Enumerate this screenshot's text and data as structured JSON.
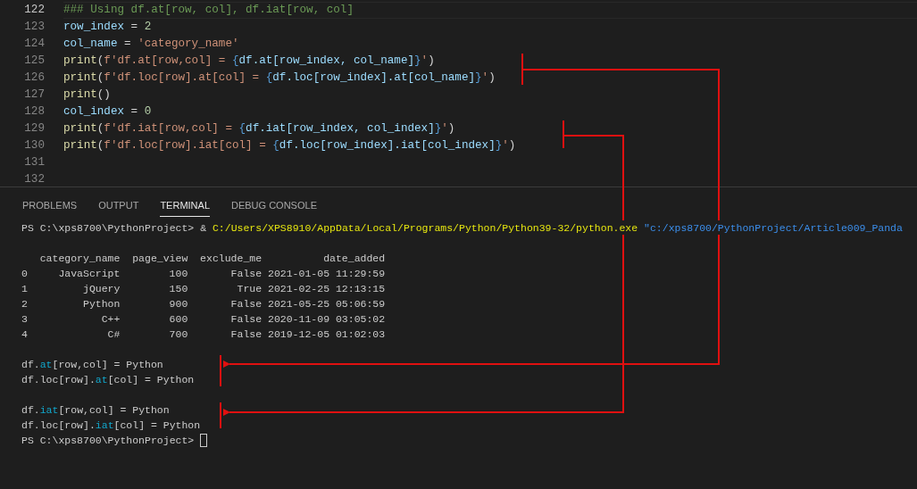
{
  "editor": {
    "lines": [
      {
        "number": "122",
        "active": true,
        "tokens": [
          {
            "text": "### Using df.at[row, col], df.iat[row, col]",
            "kind": "comment"
          }
        ]
      },
      {
        "number": "123",
        "active": false,
        "tokens": [
          {
            "text": "row_index",
            "kind": "var"
          },
          {
            "text": " = ",
            "kind": "op"
          },
          {
            "text": "2",
            "kind": "num"
          }
        ]
      },
      {
        "number": "124",
        "active": false,
        "tokens": [
          {
            "text": "col_name",
            "kind": "var"
          },
          {
            "text": " = ",
            "kind": "op"
          },
          {
            "text": "'category_name'",
            "kind": "str"
          }
        ]
      },
      {
        "number": "125",
        "active": false,
        "tokens": [
          {
            "text": "print",
            "kind": "func"
          },
          {
            "text": "(",
            "kind": "op"
          },
          {
            "text": "f'df.at[row,col] = ",
            "kind": "str"
          },
          {
            "text": "{",
            "kind": "brace"
          },
          {
            "text": "df.at[row_index, col_name]",
            "kind": "var"
          },
          {
            "text": "}",
            "kind": "brace"
          },
          {
            "text": "'",
            "kind": "str"
          },
          {
            "text": ")",
            "kind": "op"
          }
        ]
      },
      {
        "number": "126",
        "active": false,
        "tokens": [
          {
            "text": "print",
            "kind": "func"
          },
          {
            "text": "(",
            "kind": "op"
          },
          {
            "text": "f'df.loc[row].at[col] = ",
            "kind": "str"
          },
          {
            "text": "{",
            "kind": "brace"
          },
          {
            "text": "df.loc[row_index].at[col_name]",
            "kind": "var"
          },
          {
            "text": "}",
            "kind": "brace"
          },
          {
            "text": "'",
            "kind": "str"
          },
          {
            "text": ")",
            "kind": "op"
          }
        ]
      },
      {
        "number": "127",
        "active": false,
        "tokens": [
          {
            "text": "print",
            "kind": "func"
          },
          {
            "text": "()",
            "kind": "op"
          }
        ]
      },
      {
        "number": "128",
        "active": false,
        "tokens": [
          {
            "text": "col_index",
            "kind": "var"
          },
          {
            "text": " = ",
            "kind": "op"
          },
          {
            "text": "0",
            "kind": "num"
          }
        ]
      },
      {
        "number": "129",
        "active": false,
        "tokens": [
          {
            "text": "print",
            "kind": "func"
          },
          {
            "text": "(",
            "kind": "op"
          },
          {
            "text": "f'df.iat[row,col] = ",
            "kind": "str"
          },
          {
            "text": "{",
            "kind": "brace"
          },
          {
            "text": "df.iat[row_index, col_index]",
            "kind": "var"
          },
          {
            "text": "}",
            "kind": "brace"
          },
          {
            "text": "'",
            "kind": "str"
          },
          {
            "text": ")",
            "kind": "op"
          }
        ]
      },
      {
        "number": "130",
        "active": false,
        "tokens": [
          {
            "text": "print",
            "kind": "func"
          },
          {
            "text": "(",
            "kind": "op"
          },
          {
            "text": "f'df.loc[row].iat[col] = ",
            "kind": "str"
          },
          {
            "text": "{",
            "kind": "brace"
          },
          {
            "text": "df.loc[row_index].iat[col_index]",
            "kind": "var"
          },
          {
            "text": "}",
            "kind": "brace"
          },
          {
            "text": "'",
            "kind": "str"
          },
          {
            "text": ")",
            "kind": "op"
          }
        ]
      },
      {
        "number": "131",
        "active": false
      },
      {
        "number": "132",
        "active": false
      }
    ]
  },
  "panel": {
    "tabs": [
      {
        "label": "PROBLEMS",
        "selected": false
      },
      {
        "label": "OUTPUT",
        "selected": false
      },
      {
        "label": "TERMINAL",
        "selected": true
      },
      {
        "label": "DEBUG CONSOLE",
        "selected": false
      }
    ]
  },
  "terminal": {
    "command": {
      "prompt": "PS C:\\xps8700\\PythonProject>",
      "operator": "&",
      "executable": "C:/Users/XPS8910/AppData/Local/Programs/Python/Python39-32/python.exe",
      "argument": "\"c:/xps8700/PythonProject/Article009_Panda"
    },
    "table": {
      "columns": [
        "category_name",
        "page_view",
        "exclude_me",
        "date_added"
      ],
      "rows": [
        {
          "index": "0",
          "cells": [
            "JavaScript",
            "100",
            "False",
            "2021-01-05 11:29:59"
          ]
        },
        {
          "index": "1",
          "cells": [
            "jQuery",
            "150",
            "True",
            "2021-02-25 12:13:15"
          ]
        },
        {
          "index": "2",
          "cells": [
            "Python",
            "900",
            "False",
            "2021-05-25 05:06:59"
          ]
        },
        {
          "index": "3",
          "cells": [
            "C++",
            "600",
            "False",
            "2020-11-09 03:05:02"
          ]
        },
        {
          "index": "4",
          "cells": [
            "C#",
            "700",
            "False",
            "2019-12-05 01:02:03"
          ]
        }
      ]
    },
    "groups": [
      {
        "lines": [
          {
            "tokens": [
              {
                "text": "df.",
                "kind": "plain"
              },
              {
                "text": "at",
                "kind": "hl"
              },
              {
                "text": "[row,col] = Python",
                "kind": "plain"
              }
            ]
          },
          {
            "tokens": [
              {
                "text": "df.loc[row].",
                "kind": "plain"
              },
              {
                "text": "at",
                "kind": "hl"
              },
              {
                "text": "[col] = Python",
                "kind": "plain"
              }
            ]
          }
        ]
      },
      {
        "lines": [
          {
            "tokens": [
              {
                "text": "df.",
                "kind": "plain"
              },
              {
                "text": "iat",
                "kind": "hl"
              },
              {
                "text": "[row,col] = Python",
                "kind": "plain"
              }
            ]
          },
          {
            "tokens": [
              {
                "text": "df.loc[row].",
                "kind": "plain"
              },
              {
                "text": "iat",
                "kind": "hl"
              },
              {
                "text": "[col] = Python",
                "kind": "plain"
              }
            ]
          }
        ]
      }
    ],
    "final_prompt": "PS C:\\xps8700\\PythonProject>"
  }
}
